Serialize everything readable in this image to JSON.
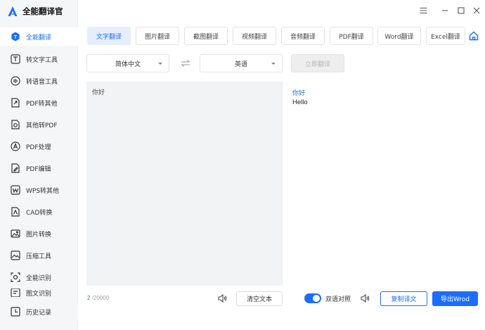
{
  "app": {
    "title": "全能翻译官",
    "accent": "#1a6dff"
  },
  "window_controls": [
    "menu-icon",
    "minimize-icon",
    "maximize-icon",
    "close-icon"
  ],
  "sidebar": {
    "items": [
      {
        "label": "全能翻译",
        "icon": "translate-icon",
        "active": true
      },
      {
        "label": "转文字工具",
        "icon": "text-convert-icon"
      },
      {
        "label": "转语音工具",
        "icon": "speech-icon"
      },
      {
        "label": "PDF转其他",
        "icon": "pdf-convert-icon"
      },
      {
        "label": "其他转PDF",
        "icon": "to-pdf-icon"
      },
      {
        "label": "PDF处理",
        "icon": "pdf-process-icon"
      },
      {
        "label": "PDF编辑",
        "icon": "pdf-edit-icon"
      },
      {
        "label": "WPS转其他",
        "icon": "wps-icon"
      },
      {
        "label": "CAD转换",
        "icon": "cad-icon"
      },
      {
        "label": "图片转换",
        "icon": "image-icon"
      },
      {
        "label": "压缩工具",
        "icon": "compress-icon"
      },
      {
        "label": "全能识别",
        "icon": "recognize-icon"
      },
      {
        "label": "图文识别",
        "icon": "ocr-icon"
      },
      {
        "label": "历史记录",
        "icon": "history-icon"
      }
    ]
  },
  "tabs": [
    {
      "label": "文字翻译",
      "active": true
    },
    {
      "label": "图片翻译"
    },
    {
      "label": "截图翻译"
    },
    {
      "label": "视频翻译"
    },
    {
      "label": "音频翻译"
    },
    {
      "label": "PDF翻译"
    },
    {
      "label": "Word翻译"
    },
    {
      "label": "Excel翻译"
    }
  ],
  "languages": {
    "source": "简体中文",
    "target": "英语"
  },
  "translate_button": "立即翻译",
  "source_text": "你好",
  "result": {
    "source_echo": "你好",
    "translation": "Hello"
  },
  "char_count": {
    "current": "2",
    "max": "/20000"
  },
  "buttons": {
    "clear": "清空文本",
    "bilingual": "双语对照",
    "copy": "复制译文",
    "export": "导出Wrod"
  },
  "bilingual_enabled": true
}
